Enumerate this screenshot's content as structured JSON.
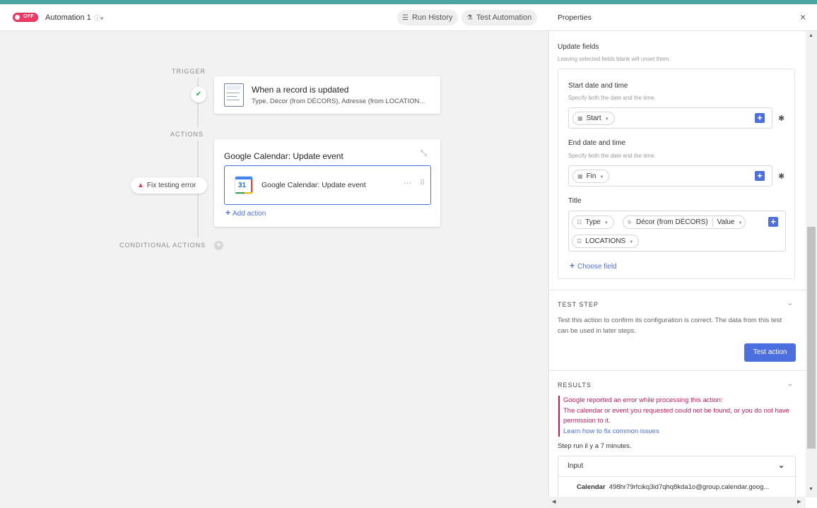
{
  "header": {
    "toggle_label": "OFF",
    "automation_name": "Automation 1",
    "info_icon": "ⓘ▾",
    "run_history_label": "Run History",
    "test_automation_label": "Test Automation"
  },
  "canvas": {
    "trigger_label": "TRIGGER",
    "actions_label": "ACTIONS",
    "conditional_actions_label": "CONDITIONAL ACTIONS",
    "fix_error_label": "Fix testing error",
    "trigger_card": {
      "title": "When a record is updated",
      "subtitle": "Type, Décor (from DÉCORS), Adresse (from LOCATION..."
    },
    "action_group": {
      "title": "Google Calendar: Update event",
      "item_label": "Google Calendar: Update event",
      "calendar_badge": "31",
      "add_action_label": "Add action"
    }
  },
  "properties": {
    "title": "Properties",
    "close_icon": "×",
    "update_fields": {
      "title": "Update fields",
      "hint": "Leaving selected fields blank will unset them.",
      "start": {
        "label": "Start date and time",
        "hint": "Specify both the date and the time.",
        "token": "Start"
      },
      "end": {
        "label": "End date and time",
        "hint": "Specify both the date and the time.",
        "token": "Fin"
      },
      "title_field": {
        "label": "Title",
        "tokens": [
          "Type",
          "Décor (from DÉCORS)",
          "Value",
          "LOCATIONS"
        ]
      },
      "choose_field_label": "Choose field"
    },
    "test_step": {
      "title": "TEST STEP",
      "description": "Test this action to confirm its configuration is correct. The data from this test can be used in later steps.",
      "button_label": "Test action"
    },
    "results": {
      "title": "RESULTS",
      "error_line1": "Google reported an error while processing this action:",
      "error_line2": "The calendar or event you requested could not be found, or you do not have permission to it.",
      "learn_link": "Learn how to fix common issues",
      "step_run": "Step run il y a 7 minutes.",
      "input_label": "Input",
      "calendar_key": "Calendar",
      "calendar_value": "498hr79rfcikq3id7qhq8kda1o@group.calendar.goog..."
    }
  },
  "colors": {
    "accent": "#4c6fe0",
    "toggle_off": "#ef3a63",
    "error": "#c2185b",
    "topbar": "#4aa5a0"
  }
}
